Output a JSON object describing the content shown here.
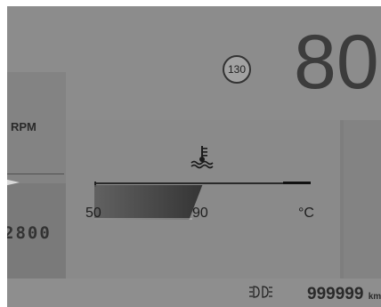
{
  "tachometer": {
    "label": "RPM",
    "value": "2800"
  },
  "speedometer": {
    "speed": "80",
    "speed_limit": "130"
  },
  "coolant_gauge": {
    "icon": "coolant-temperature-icon",
    "min_label": "50",
    "max_label": "90",
    "unit": "°C",
    "level_fraction": 0.45
  },
  "odometer": {
    "icon": "odometer-icon",
    "value": "999999",
    "unit": "km"
  },
  "colors": {
    "screen_background": "#8c8c8c",
    "text_dark": "#2a2a2a",
    "gauge_fill": "#3c3c3c"
  }
}
